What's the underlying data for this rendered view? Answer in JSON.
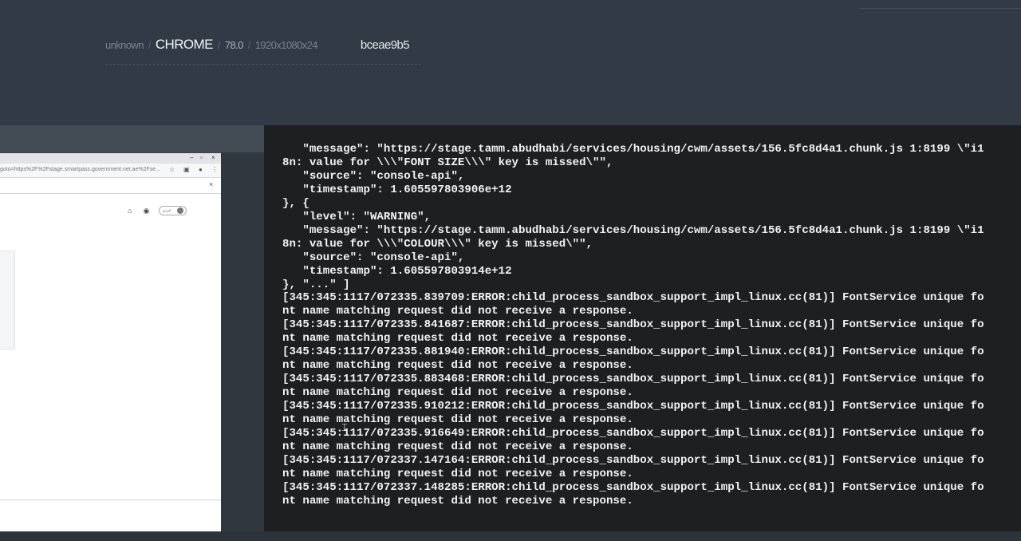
{
  "session": {
    "os": "unknown",
    "separator": "/",
    "browser": "CHROME",
    "version": "78.0",
    "resolution": "1920x1080x24",
    "session_id": "bceae9b5"
  },
  "screenshot": {
    "window_controls": {
      "minimize": "–",
      "maximize": "▫",
      "close": "×"
    },
    "url": "goto=https%2F%2Fstage.smartpass.government.net.ae%2Fse...",
    "infobar_close": "×",
    "lang_toggle": "عربي"
  },
  "console": {
    "lines": [
      "   \"message\": \"https://stage.tamm.abudhabi/services/housing/cwm/assets/156.5fc8d4a1.chunk.js 1:8199 \\\"i1",
      "8n: value for \\\\\\\"FONT SIZE\\\\\\\" key is missed\\\"\",",
      "   \"source\": \"console-api\",",
      "   \"timestamp\": 1.605597803906e+12",
      "}, {",
      "   \"level\": \"WARNING\",",
      "   \"message\": \"https://stage.tamm.abudhabi/services/housing/cwm/assets/156.5fc8d4a1.chunk.js 1:8199 \\\"i1",
      "8n: value for \\\\\\\"COLOUR\\\\\\\" key is missed\\\"\",",
      "   \"source\": \"console-api\",",
      "   \"timestamp\": 1.605597803914e+12",
      "}, \"...\" ]",
      "[345:345:1117/072335.839709:ERROR:child_process_sandbox_support_impl_linux.cc(81)] FontService unique fo",
      "nt name matching request did not receive a response.",
      "[345:345:1117/072335.841687:ERROR:child_process_sandbox_support_impl_linux.cc(81)] FontService unique fo",
      "nt name matching request did not receive a response.",
      "[345:345:1117/072335.881940:ERROR:child_process_sandbox_support_impl_linux.cc(81)] FontService unique fo",
      "nt name matching request did not receive a response.",
      "[345:345:1117/072335.883468:ERROR:child_process_sandbox_support_impl_linux.cc(81)] FontService unique fo",
      "nt name matching request did not receive a response.",
      "[345:345:1117/072335.910212:ERROR:child_process_sandbox_support_impl_linux.cc(81)] FontService unique fo",
      "nt name matching request did not receive a response.",
      "[345:345:1117/072335.916649:ERROR:child_process_sandbox_support_impl_linux.cc(81)] FontService unique fo",
      "nt name matching request did not receive a response.",
      "[345:345:1117/072337.147164:ERROR:child_process_sandbox_support_impl_linux.cc(81)] FontService unique fo",
      "nt name matching request did not receive a response.",
      "[345:345:1117/072337.148285:ERROR:child_process_sandbox_support_impl_linux.cc(81)] FontService unique fo",
      "nt name matching request did not receive a response."
    ]
  },
  "colors": {
    "page_background": "#323a45",
    "console_background": "#1d1f21",
    "console_text": "#f3f3f3"
  }
}
